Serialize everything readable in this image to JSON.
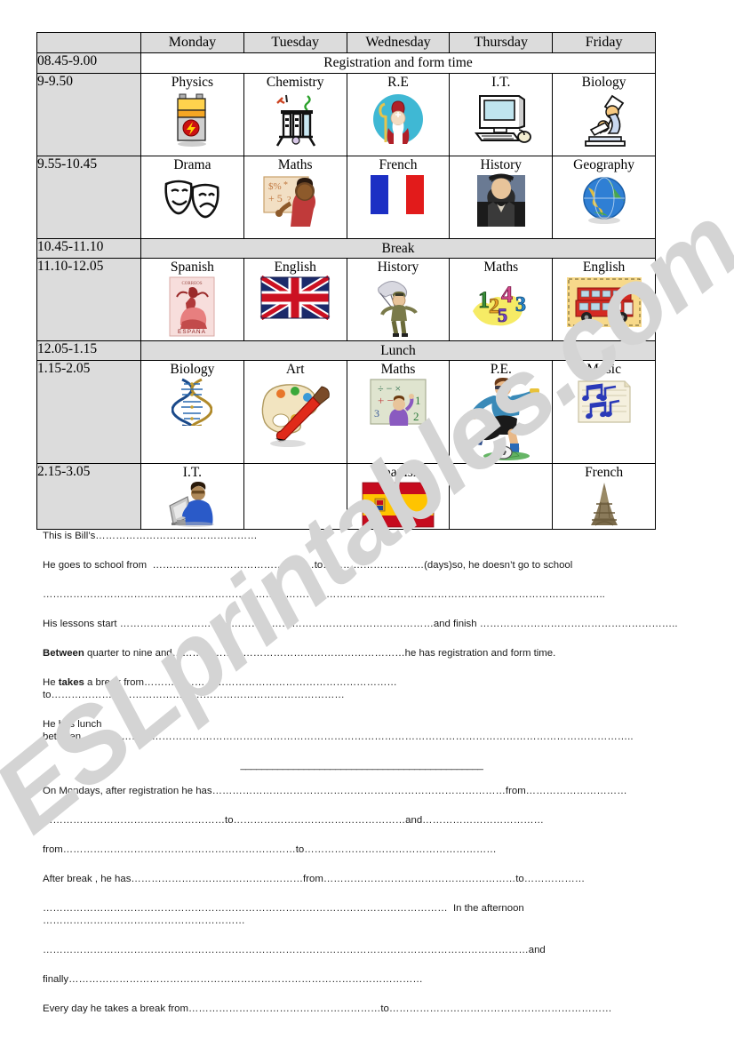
{
  "watermark": {
    "text": "ESLprintables.com"
  },
  "timetable": {
    "corner_label": "",
    "days": [
      "Monday",
      "Tuesday",
      "Wednesday",
      "Thursday",
      "Friday"
    ],
    "rows": [
      {
        "time": "08.45-9.00",
        "type": "wide",
        "label": "Registration and form time",
        "shaded": false
      },
      {
        "time": "9-9.50",
        "type": "lessons",
        "cells": [
          {
            "subject": "Physics",
            "icon": "battery-icon"
          },
          {
            "subject": "Chemistry",
            "icon": "test-tubes-icon"
          },
          {
            "subject": "R.E",
            "icon": "bishop-icon"
          },
          {
            "subject": "I.T.",
            "icon": "computer-icon"
          },
          {
            "subject": "Biology",
            "icon": "microscope-icon"
          }
        ]
      },
      {
        "time": "9.55-10.45",
        "type": "lessons",
        "cells": [
          {
            "subject": "Drama",
            "icon": "theatre-masks-icon"
          },
          {
            "subject": "Maths",
            "icon": "teacher-board-icon"
          },
          {
            "subject": "French",
            "icon": "french-flag-icon"
          },
          {
            "subject": "History",
            "icon": "portrait-icon"
          },
          {
            "subject": "Geography",
            "icon": "globe-icon"
          }
        ]
      },
      {
        "time": "10.45-11.10",
        "type": "wide",
        "label": "Break",
        "shaded": true
      },
      {
        "time": "11.10-12.05",
        "type": "lessons",
        "cells": [
          {
            "subject": "Spanish",
            "icon": "flamenco-stamp-icon"
          },
          {
            "subject": "English",
            "icon": "union-jack-icon"
          },
          {
            "subject": "History",
            "icon": "parachute-soldier-icon"
          },
          {
            "subject": "Maths",
            "icon": "numbers-icon"
          },
          {
            "subject": "English",
            "icon": "london-bus-icon"
          }
        ]
      },
      {
        "time": "12.05-1.15",
        "type": "wide",
        "label": "Lunch",
        "shaded": true
      },
      {
        "time": "1.15-2.05",
        "type": "lessons",
        "cells": [
          {
            "subject": "Biology",
            "icon": "dna-icon"
          },
          {
            "subject": "Art",
            "icon": "palette-icon"
          },
          {
            "subject": "Maths",
            "icon": "maths-board-icon"
          },
          {
            "subject": "P.E.",
            "icon": "footballer-icon"
          },
          {
            "subject": "Music",
            "icon": "music-notes-icon"
          }
        ]
      },
      {
        "time": "2.15-3.05",
        "type": "lessons",
        "cells": [
          {
            "subject": "I.T.",
            "icon": "person-computer-icon"
          },
          {
            "subject": "",
            "icon": ""
          },
          {
            "subject": "Spanish",
            "icon": "spanish-flag-icon"
          },
          {
            "subject": "",
            "icon": ""
          },
          {
            "subject": "French",
            "icon": "eiffel-tower-icon"
          }
        ]
      }
    ]
  },
  "exercise": {
    "line1": "This is Bill’s…………………………………………",
    "line2": "He goes to school from  …………………………………………to…………………………(days)so, he doesn’t go to school",
    "line3": "…………………………………………………………………………………………………………………………………………………..",
    "line4": "His lessons start …………………………………………………………………………………and finish …………………………………………………..",
    "line5_bold": "Between",
    "line5_rest": " quarter to nine and……………………………………………………………he has registration and form time.",
    "line6_a": "He ",
    "line6_bold": "takes",
    "line6_rest": " a break from…………………………………………………………………to……………………………………………………………………………",
    "line7": "He has lunch between………………………………………………………………………………………………………………………………………………..",
    "divider": "______________________________________________",
    "line8": "On Mondays, after registration he has……………………………………………………………………………from…………………………",
    "line9": "………………………………………………to……………………………………………and………………………………",
    "line10": "from……………………………………………………………to…………………………………………………",
    "line11": "After break , he has……………………………………………from…………………………………………………to………………",
    "line12": "…………………………………………………………………………………………………………  In the afternoon ……………………………………………………",
    "line13": "………………………………………………………………………………………………………………………………and",
    "line14": "finally……………………………………………………………………………………………",
    "line15": "Every day he takes a break from…………………………………………………to…………………………………………………………"
  }
}
